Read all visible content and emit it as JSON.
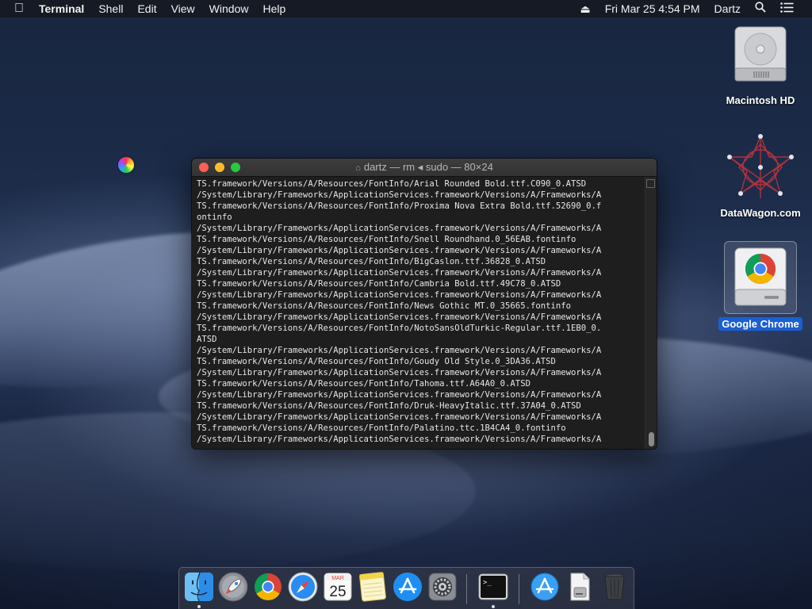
{
  "menubar": {
    "app_name": "Terminal",
    "menus": [
      "Shell",
      "Edit",
      "View",
      "Window",
      "Help"
    ],
    "clock": "Fri Mar 25  4:54 PM",
    "user": "Dartz"
  },
  "desktop_icons": {
    "hd": "Macintosh HD",
    "datawagon": "DataWagon.com",
    "chrome": "Google Chrome"
  },
  "terminal": {
    "title": "dartz — rm ◂ sudo — 80×24",
    "lines": [
      "TS.framework/Versions/A/Resources/FontInfo/Arial Rounded Bold.ttf.C090_0.ATSD",
      "/System/Library/Frameworks/ApplicationServices.framework/Versions/A/Frameworks/A",
      "TS.framework/Versions/A/Resources/FontInfo/Proxima Nova Extra Bold.ttf.52690_0.f",
      "ontinfo",
      "/System/Library/Frameworks/ApplicationServices.framework/Versions/A/Frameworks/A",
      "TS.framework/Versions/A/Resources/FontInfo/Snell Roundhand.0_56EAB.fontinfo",
      "/System/Library/Frameworks/ApplicationServices.framework/Versions/A/Frameworks/A",
      "TS.framework/Versions/A/Resources/FontInfo/BigCaslon.ttf.36828_0.ATSD",
      "/System/Library/Frameworks/ApplicationServices.framework/Versions/A/Frameworks/A",
      "TS.framework/Versions/A/Resources/FontInfo/Cambria Bold.ttf.49C78_0.ATSD",
      "/System/Library/Frameworks/ApplicationServices.framework/Versions/A/Frameworks/A",
      "TS.framework/Versions/A/Resources/FontInfo/News Gothic MT.0_35665.fontinfo",
      "/System/Library/Frameworks/ApplicationServices.framework/Versions/A/Frameworks/A",
      "TS.framework/Versions/A/Resources/FontInfo/NotoSansOldTurkic-Regular.ttf.1EB0_0.",
      "ATSD",
      "/System/Library/Frameworks/ApplicationServices.framework/Versions/A/Frameworks/A",
      "TS.framework/Versions/A/Resources/FontInfo/Goudy Old Style.0_3DA36.ATSD",
      "/System/Library/Frameworks/ApplicationServices.framework/Versions/A/Frameworks/A",
      "TS.framework/Versions/A/Resources/FontInfo/Tahoma.ttf.A64A0_0.ATSD",
      "/System/Library/Frameworks/ApplicationServices.framework/Versions/A/Frameworks/A",
      "TS.framework/Versions/A/Resources/FontInfo/Druk-HeavyItalic.ttf.37A04_0.ATSD",
      "/System/Library/Frameworks/ApplicationServices.framework/Versions/A/Frameworks/A",
      "TS.framework/Versions/A/Resources/FontInfo/Palatino.ttc.1B4CA4_0.fontinfo",
      "/System/Library/Frameworks/ApplicationServices.framework/Versions/A/Frameworks/A"
    ]
  },
  "dock": {
    "calendar_month": "MAR",
    "calendar_day": "25",
    "terminal_prompt": ">_"
  },
  "colors": {
    "selection": "#1b5fd1",
    "close": "#fc5f57",
    "minimize": "#fdbc2e",
    "maximize": "#28c840",
    "terminal_bg": "#1e1e1e"
  }
}
